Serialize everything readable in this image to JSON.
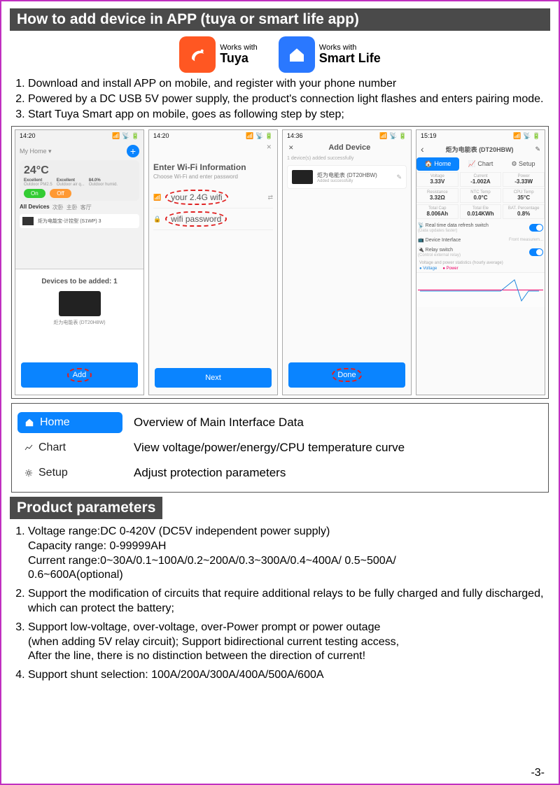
{
  "header1": "How to add device in APP (tuya or smart life app)",
  "logos": {
    "works_with": "Works with",
    "tuya": "Tuya",
    "smartlife": "Smart Life"
  },
  "steps": [
    "Download and install APP on mobile, and register with your phone number",
    "Powered by a DC USB 5V power supply, the product's connection light flashes and enters pairing mode.",
    "Start Tuya Smart app on mobile, goes as following step by step;"
  ],
  "phone1": {
    "time": "14:20",
    "home_label": "My Home ▾",
    "temp": "24°C",
    "stat1_t": "Excellent",
    "stat1_s": "Outdoor PM2.5",
    "stat2_t": "Excellent",
    "stat2_s": "Outdoor air q...",
    "stat3_t": "84.0%",
    "stat3_s": "Outdoor humid.",
    "on": "On",
    "off": "Off",
    "alldev": "All Devices",
    "t2": "次卧",
    "t3": "主卧",
    "t4": "客厅",
    "devline": "炬为电能宝-计控型 (S1WP) 3",
    "modal_title": "Devices to be added: 1",
    "modal_dev": "炬为电能表 (DT20H8W)",
    "btn": "Add"
  },
  "phone2": {
    "time": "14:20",
    "close": "✕",
    "title": "Enter Wi-Fi Information",
    "sub": "Choose Wi-Fi and enter password",
    "wifi": "your 2.4G wifi",
    "pwd": "wifi password",
    "btn": "Next"
  },
  "phone3": {
    "time": "14:36",
    "close": "✕",
    "title": "Add Device",
    "sub": "1 device(s) added successfully",
    "dev": "炬为电能表 (DT20HBW)",
    "dev_sub": "Added successfully",
    "btn": "Done"
  },
  "phone4": {
    "time": "15:19",
    "back": "‹",
    "title": "炬为电能表 (DT20HBW)",
    "edit": "✎",
    "tab_home": "Home",
    "tab_chart": "Chart",
    "tab_setup": "Setup",
    "cells": [
      {
        "l": "Voltage",
        "v": "3.33V"
      },
      {
        "l": "Current",
        "v": "-1.002A"
      },
      {
        "l": "Power",
        "v": "-3.33W"
      },
      {
        "l": "Resistance",
        "v": "3.32Ω"
      },
      {
        "l": "NTC Temp",
        "v": "0.0°C"
      },
      {
        "l": "CPU Temp",
        "v": "35°C"
      },
      {
        "l": "Total Cap",
        "v": "8.006Ah"
      },
      {
        "l": "Total Ele",
        "v": "0.014KWh"
      },
      {
        "l": "BAT. Percentage",
        "v": "0.8%"
      }
    ],
    "row1": "Real time data refresh switch",
    "row1s": "(Data updates faster)",
    "row2": "Device Interface",
    "row2r": "Front measurem...",
    "row3": "Relay switch",
    "row3s": "(Control external relay)",
    "chart_t": "Voltage and power statistics (hourly average)",
    "leg_v": "Voltage",
    "leg_p": "Power"
  },
  "legend": {
    "home": "Home",
    "home_d": "Overview of Main Interface Data",
    "chart": "Chart",
    "chart_d": "View voltage/power/energy/CPU temperature curve",
    "setup": "Setup",
    "setup_d": "Adjust protection parameters"
  },
  "header2": "Product parameters",
  "params": [
    "Voltage range:DC 0-420V (DC5V independent power supply)\n   Capacity range: 0-99999AH\nCurrent range:0~30A/0.1~100A/0.2~200A/0.3~300A/0.4~400A/ 0.5~500A/\n                          0.6~600A(optional)",
    "Support the modification of circuits that require additional relays to be fully charged and fully discharged, which can protect the battery;",
    "Support low-voltage, over-voltage, over-Power prompt or power outage\n(when adding 5V relay circuit); Support bidirectional current testing access,\nAfter the line, there is no distinction between the direction of current!",
    "Support shunt selection: 100A/200A/300A/400A/500A/600A"
  ],
  "page": "-3-"
}
